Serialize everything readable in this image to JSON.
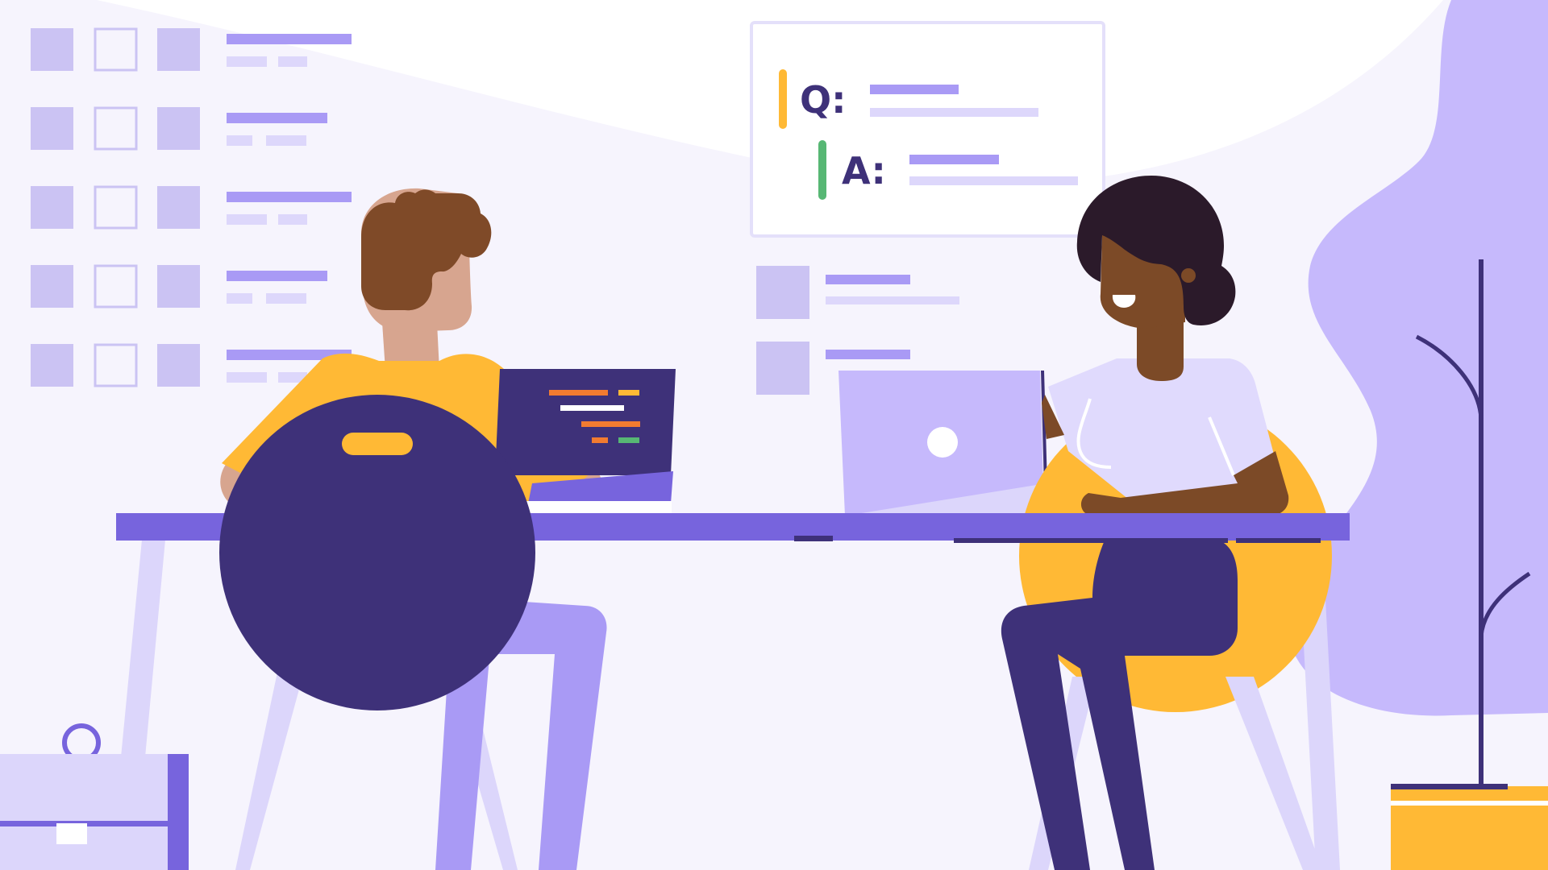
{
  "board": {
    "question_label": "Q:",
    "answer_label": "A:"
  },
  "colors": {
    "background": "#f6f4fd",
    "lavender_light": "#dcd6fb",
    "lavender": "#c6b9fc",
    "purple_mid": "#a99af5",
    "purple": "#7764dd",
    "navy": "#3e3179",
    "yellow": "#ffb935",
    "brown_hair": "#7f4a28",
    "skin_light": "#d7a58f",
    "skin_dark": "#7c4a27",
    "hair_dark": "#2b1a2a",
    "green": "#57b774",
    "orange": "#f27b30"
  },
  "icons": [
    "checklist-illustration",
    "question-answer-board",
    "laptop-icon",
    "briefcase-icon",
    "plant-illustration"
  ]
}
